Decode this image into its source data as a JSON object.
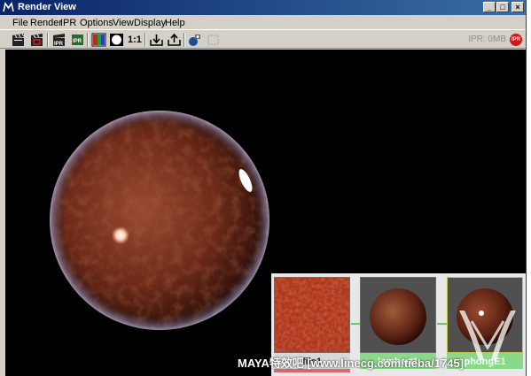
{
  "window": {
    "title": "Render View",
    "title_icon": "maya-icon"
  },
  "window_buttons": [
    "_",
    "□",
    "×"
  ],
  "menu": [
    "File",
    "Render",
    "IPR",
    "Options",
    "View",
    "Display",
    "Help"
  ],
  "toolbar": {
    "zoom_label": "1:1",
    "ipr_status": "IPR: 0MB",
    "ipr_badge": "IPR",
    "icons": [
      "clapboard-icon",
      "clapboard-region-icon",
      "ipr-clapboard-icon",
      "ipr-refresh-icon",
      "rgb-channel-icon",
      "alpha-channel-icon",
      "real-size-icon",
      "keep-image-icon",
      "remove-image-icon",
      "snapshot-icon",
      "region-select-icon"
    ]
  },
  "hypershade": {
    "swatches": [
      {
        "name": "file1",
        "kind": "texture"
      },
      {
        "name": "lambert1",
        "kind": "material-ball"
      },
      {
        "name": "phongE1",
        "kind": "material-ball-highlight"
      }
    ]
  },
  "watermark": {
    "text": "MAYA特效吧 [www.linecg.com/tieba/1745]"
  },
  "colors": {
    "title_bar": "#0a246a",
    "chrome": "#d4d0c8",
    "viewport": "#000000",
    "sphere": "#7a2a18",
    "swatch_panel": "#e8e8e8",
    "connector": "#5ad35a"
  }
}
